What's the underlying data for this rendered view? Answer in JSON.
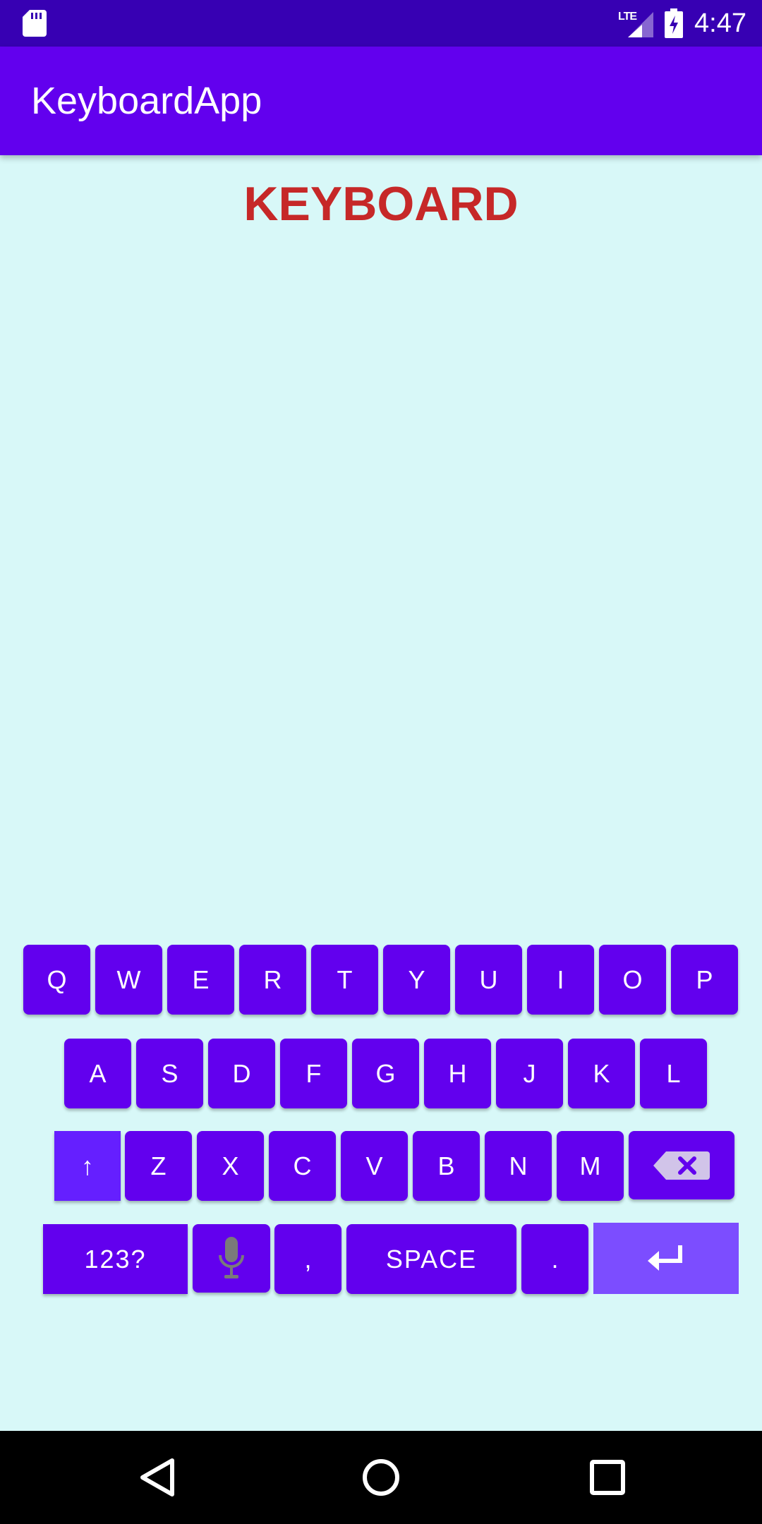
{
  "status_bar": {
    "time": "4:47",
    "network": "LTE",
    "icons": [
      "sd-card-icon",
      "signal-icon",
      "battery-charging-icon"
    ]
  },
  "app_bar": {
    "title": "KeyboardApp"
  },
  "heading": "KEYBOARD",
  "keyboard": {
    "row1": [
      "Q",
      "W",
      "E",
      "R",
      "T",
      "Y",
      "U",
      "I",
      "O",
      "P"
    ],
    "row2": [
      "A",
      "S",
      "D",
      "F",
      "G",
      "H",
      "J",
      "K",
      "L"
    ],
    "row3": [
      "Z",
      "X",
      "C",
      "V",
      "B",
      "N",
      "M"
    ],
    "shift_label": "↑",
    "symbols_label": "123?",
    "comma_label": ",",
    "space_label": "SPACE",
    "period_label": ".",
    "special_icons": [
      "backspace-icon",
      "mic-icon",
      "enter-icon"
    ],
    "key_color": "#6200ee",
    "shift_color": "#651fff",
    "enter_color": "#7c4dff"
  },
  "nav_bar": {
    "icons": [
      "back-icon",
      "home-icon",
      "recents-icon"
    ]
  },
  "colors": {
    "status_bar": "#3700b3",
    "app_bar": "#6200ee",
    "background": "#d8f8f8",
    "heading": "#c62828"
  }
}
